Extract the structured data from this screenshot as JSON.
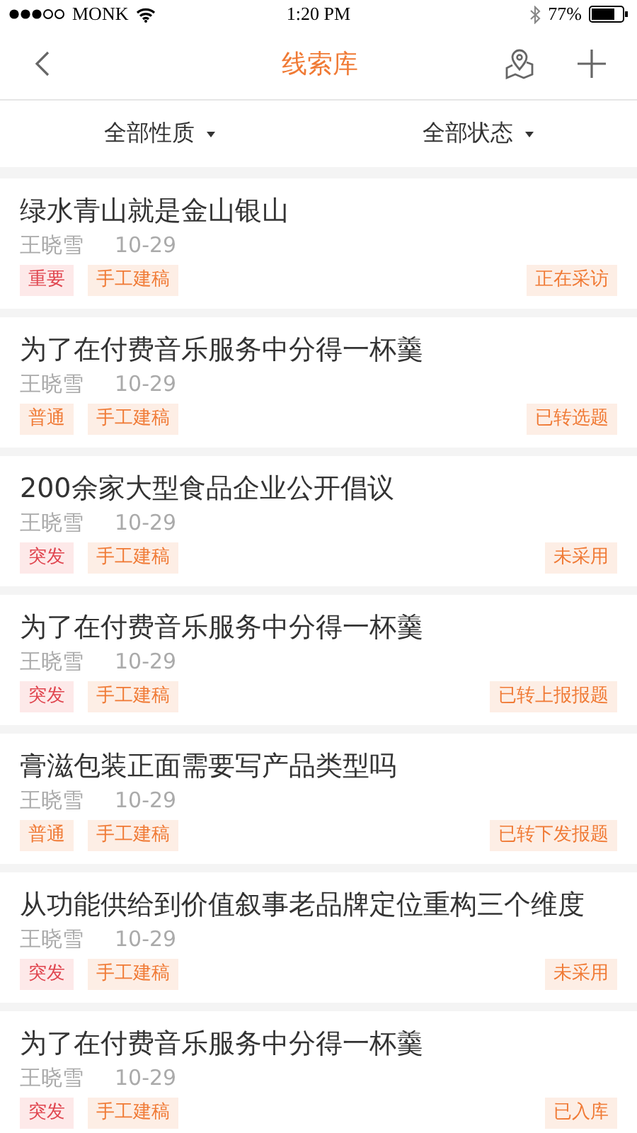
{
  "status_bar": {
    "carrier": "MONK",
    "time": "1:20 PM",
    "battery": "77%"
  },
  "nav": {
    "title": "线索库"
  },
  "filters": [
    {
      "label": "全部性质"
    },
    {
      "label": "全部状态"
    }
  ],
  "clues": [
    {
      "title": "绿水青山就是金山银山",
      "author": "王晓雪",
      "date": "10-29",
      "priority": {
        "label": "重要",
        "kind": "alert"
      },
      "source": "手工建稿",
      "status": "正在采访"
    },
    {
      "title": "为了在付费音乐服务中分得一杯羹",
      "author": "王晓雪",
      "date": "10-29",
      "priority": {
        "label": "普通",
        "kind": "normal"
      },
      "source": "手工建稿",
      "status": "已转选题"
    },
    {
      "title": "200余家大型食品企业公开倡议",
      "author": "王晓雪",
      "date": "10-29",
      "priority": {
        "label": "突发",
        "kind": "alert"
      },
      "source": "手工建稿",
      "status": "未采用"
    },
    {
      "title": "为了在付费音乐服务中分得一杯羹",
      "author": "王晓雪",
      "date": "10-29",
      "priority": {
        "label": "突发",
        "kind": "alert"
      },
      "source": "手工建稿",
      "status": "已转上报报题"
    },
    {
      "title": "膏滋包装正面需要写产品类型吗",
      "author": "王晓雪",
      "date": "10-29",
      "priority": {
        "label": "普通",
        "kind": "normal"
      },
      "source": "手工建稿",
      "status": "已转下发报题"
    },
    {
      "title": "从功能供给到价值叙事老品牌定位重构三个维度",
      "author": "王晓雪",
      "date": "10-29",
      "priority": {
        "label": "突发",
        "kind": "alert"
      },
      "source": "手工建稿",
      "status": "未采用"
    },
    {
      "title": "为了在付费音乐服务中分得一杯羹",
      "author": "王晓雪",
      "date": "10-29",
      "priority": {
        "label": "突发",
        "kind": "alert"
      },
      "source": "手工建稿",
      "status": "已入库"
    }
  ]
}
